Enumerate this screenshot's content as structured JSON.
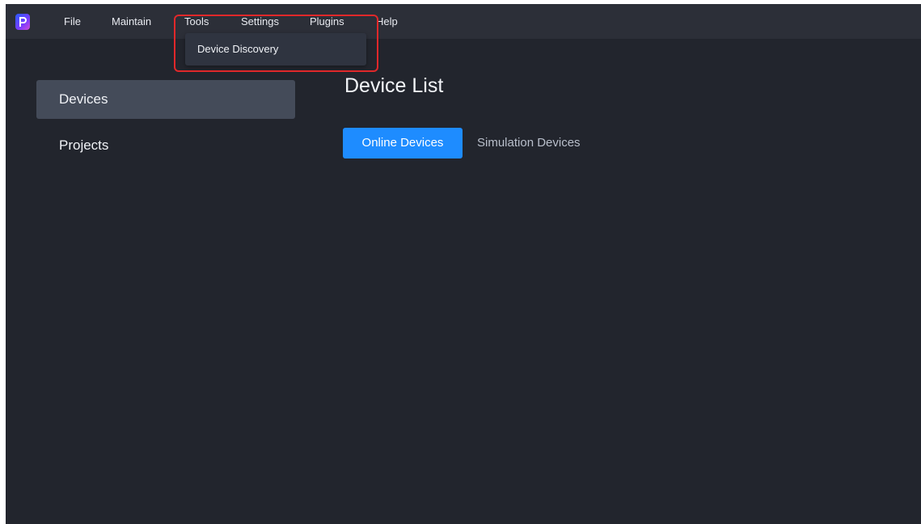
{
  "menubar": {
    "logo_icon": "app-logo-icon",
    "items": [
      "File",
      "Maintain",
      "Tools",
      "Settings",
      "Plugins",
      "Help"
    ]
  },
  "tools_menu": {
    "items": [
      "Device Discovery"
    ]
  },
  "sidebar": {
    "items": [
      {
        "label": "Devices",
        "active": true
      },
      {
        "label": "Projects",
        "active": false
      }
    ]
  },
  "main": {
    "title": "Device List",
    "tabs": [
      {
        "label": "Online Devices",
        "active": true
      },
      {
        "label": "Simulation Devices",
        "active": false
      }
    ]
  },
  "colors": {
    "background": "#22252d",
    "menubar": "#2c2f38",
    "accent": "#1e8cff",
    "sidebar_active": "#444b59",
    "highlight_box": "#e0282a"
  }
}
